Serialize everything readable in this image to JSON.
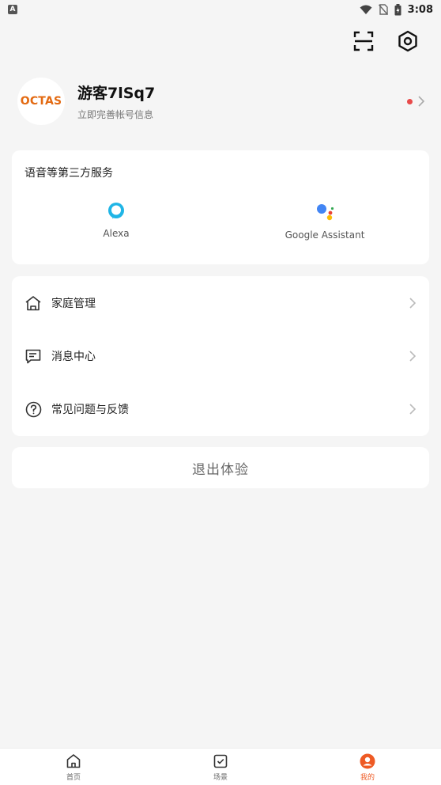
{
  "status_bar": {
    "app_icon_letter": "A",
    "time": "3:08"
  },
  "profile": {
    "avatar_text": "OCTAS",
    "name": "游客7lSq7",
    "subtitle": "立即完善帐号信息"
  },
  "services": {
    "title": "语音等第三方服务",
    "items": [
      {
        "label": "Alexa",
        "icon": "alexa-icon"
      },
      {
        "label": "Google Assistant",
        "icon": "google-assistant-icon"
      }
    ]
  },
  "menu": {
    "items": [
      {
        "label": "家庭管理",
        "icon": "home-outline-icon"
      },
      {
        "label": "消息中心",
        "icon": "message-icon"
      },
      {
        "label": "常见问题与反馈",
        "icon": "help-circle-icon"
      }
    ]
  },
  "logout": {
    "label": "退出体验"
  },
  "bottom_nav": {
    "items": [
      {
        "label": "首页",
        "icon": "home-icon",
        "active": false
      },
      {
        "label": "场景",
        "icon": "scene-check-icon",
        "active": false
      },
      {
        "label": "我的",
        "icon": "profile-icon",
        "active": true
      }
    ]
  },
  "colors": {
    "accent": "#ee5a24",
    "brand_orange": "#e36a12",
    "notification_dot": "#e84a4a",
    "background": "#f5f5f5"
  }
}
